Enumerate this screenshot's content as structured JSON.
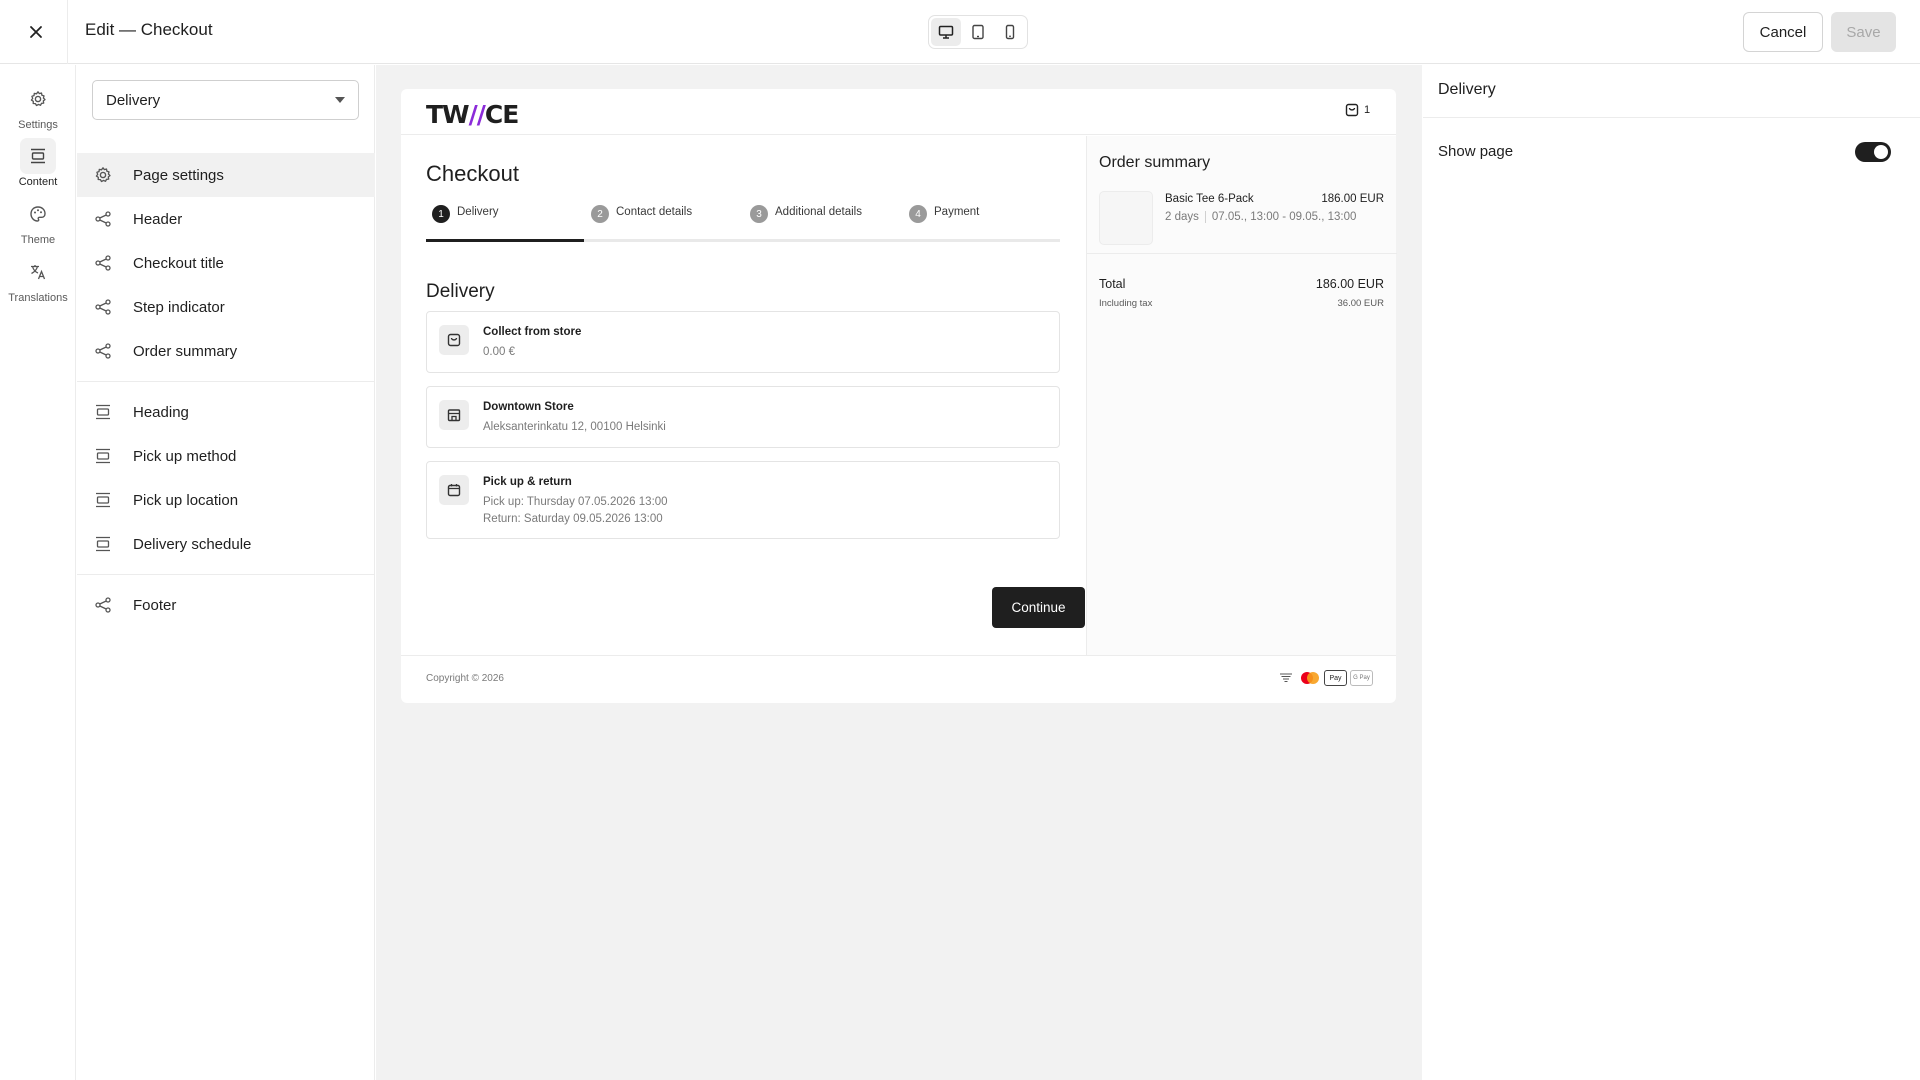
{
  "topbar": {
    "title": "Edit — Checkout",
    "cancel_label": "Cancel",
    "save_label": "Save"
  },
  "rail": {
    "items": [
      {
        "label": "Settings",
        "icon": "gear-icon"
      },
      {
        "label": "Content",
        "icon": "content-icon",
        "active": true
      },
      {
        "label": "Theme",
        "icon": "palette-icon"
      },
      {
        "label": "Translations",
        "icon": "translate-icon"
      }
    ]
  },
  "panel": {
    "select_value": "Delivery",
    "items": [
      {
        "label": "Page settings",
        "icon": "gear-icon"
      },
      {
        "label": "Header",
        "icon": "share-icon"
      },
      {
        "label": "Checkout title",
        "icon": "share-icon"
      },
      {
        "label": "Step indicator",
        "icon": "share-icon"
      },
      {
        "label": "Order summary",
        "icon": "share-icon"
      },
      {
        "label": "Heading",
        "icon": "section-icon"
      },
      {
        "label": "Pick up method",
        "icon": "section-icon"
      },
      {
        "label": "Pick up location",
        "icon": "section-icon"
      },
      {
        "label": "Delivery schedule",
        "icon": "section-icon"
      },
      {
        "label": "Footer",
        "icon": "share-icon"
      }
    ]
  },
  "preview": {
    "logo": {
      "part1": "TW",
      "part2": "//",
      "part3": "CE"
    },
    "cart_count": "1",
    "checkout_title": "Checkout",
    "steps": [
      {
        "num": "1",
        "label": "Delivery"
      },
      {
        "num": "2",
        "label": "Contact details"
      },
      {
        "num": "3",
        "label": "Additional details"
      },
      {
        "num": "4",
        "label": "Payment"
      }
    ],
    "section_title": "Delivery",
    "options": [
      {
        "title": "Collect from store",
        "lines": [
          "0.00 €"
        ],
        "icon": "bag-icon"
      },
      {
        "title": "Downtown Store",
        "lines": [
          "Aleksanterinkatu 12, 00100 Helsinki"
        ],
        "icon": "store-icon"
      },
      {
        "title": "Pick up & return",
        "lines": [
          "Pick up: Thursday 07.05.2026 13:00",
          "Return: Saturday 09.05.2026 13:00"
        ],
        "icon": "calendar-icon"
      }
    ],
    "continue_label": "Continue",
    "order_summary": {
      "title": "Order summary",
      "item_name": "Basic Tee 6-Pack",
      "item_price": "186.00 EUR",
      "item_duration": "2 days",
      "item_dates": "07.05., 13:00 - 09.05., 13:00",
      "total_label": "Total",
      "total_value": "186.00 EUR",
      "tax_label": "Including tax",
      "tax_value": "36.00 EUR"
    },
    "copyright": "Copyright © 2026",
    "pay_labels": {
      "applepay": "Pay",
      "gpay": "G Pay"
    }
  },
  "rpanel": {
    "title": "Delivery",
    "show_page_label": "Show page",
    "show_page_on": true
  },
  "colors": {
    "accent": "#8b2bd9",
    "dark": "#1f1f1f"
  }
}
